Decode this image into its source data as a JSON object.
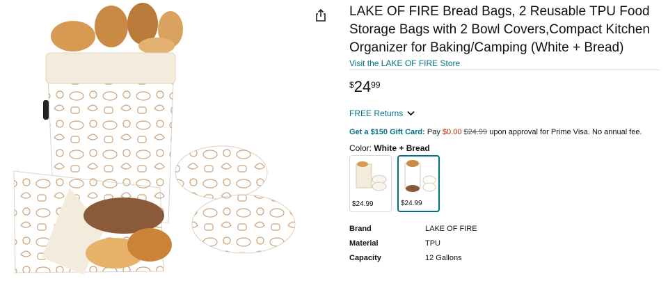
{
  "product": {
    "title": "LAKE OF FIRE Bread Bags, 2 Reusable TPU Food Storage Bags with 2 Bowl Covers,Compact Kitchen Organizer for Baking/Camping (White + Bread)",
    "store_link": "Visit the LAKE OF FIRE Store",
    "price": {
      "symbol": "$",
      "whole": "24",
      "fraction": "99"
    },
    "returns_label": "FREE Returns",
    "gift_card": {
      "headline": "Get a $150 Gift Card:",
      "pay_text": "Pay",
      "new_price": "$0.00",
      "old_price": "$24.99",
      "rest": "upon approval for Prime Visa. No annual fee."
    },
    "color": {
      "label": "Color:",
      "value": "White + Bread"
    },
    "swatches": [
      {
        "price": "$24.99",
        "selected": false
      },
      {
        "price": "$24.99",
        "selected": true
      }
    ],
    "specs": [
      {
        "key": "Brand",
        "value": "LAKE OF FIRE"
      },
      {
        "key": "Material",
        "value": "TPU"
      },
      {
        "key": "Capacity",
        "value": "12 Gallons"
      }
    ]
  },
  "icons": {
    "share": "share-icon",
    "returns_chevron": "chevron-down-icon"
  },
  "colors": {
    "link": "#007185",
    "price_red": "#b12704",
    "text": "#0f1111",
    "selected_border": "#007185"
  }
}
